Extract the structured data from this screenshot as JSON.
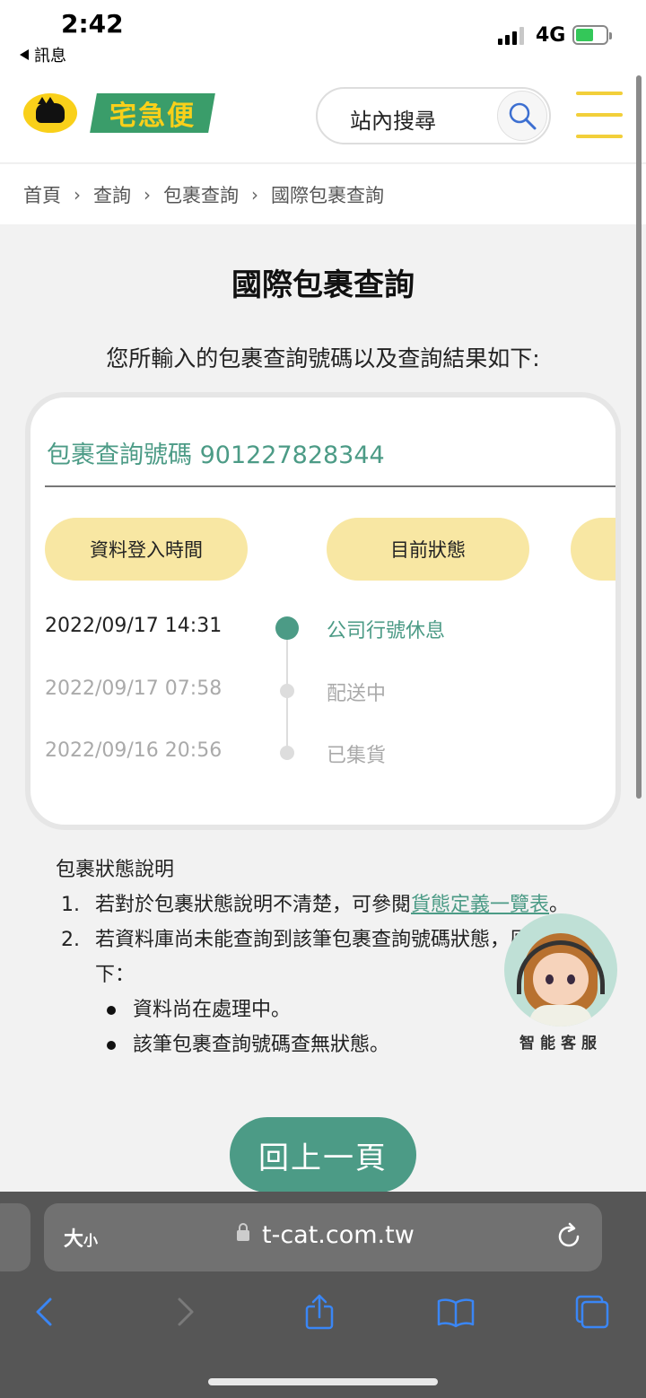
{
  "status_bar": {
    "time": "2:42",
    "back_label": "訊息",
    "network": "4G",
    "battery_percent": 60
  },
  "header": {
    "logo_text": "宅急便",
    "search_label": "站內搜尋"
  },
  "breadcrumb": [
    "首頁",
    "查詢",
    "包裹查詢",
    "國際包裹查詢"
  ],
  "main": {
    "title": "國際包裹查詢",
    "subtitle": "您所輸入的包裹查詢號碼以及查詢結果如下:"
  },
  "card": {
    "tracking_label": "包裹查詢號碼 901227828344",
    "columns": [
      "資料登入時間",
      "目前狀態",
      ""
    ],
    "rows": [
      {
        "time": "2022/09/17 14:31",
        "status": "公司行號休息"
      },
      {
        "time": "2022/09/17 07:58",
        "status": "配送中"
      },
      {
        "time": "2022/09/16 20:56",
        "status": "已集貨"
      }
    ]
  },
  "notes": {
    "heading": "包裹狀態說明",
    "item1_num": "1.",
    "item1_prefix": "若對於包裹狀態說明不清楚，可參閱",
    "item1_link": "貨態定義一覽表",
    "item1_suffix": "。",
    "item2_num": "2.",
    "item2_text": "若資料庫尚未能查詢到該筆包裹查詢號碼狀態，原因如下：",
    "bullets": [
      "資料尚在處理中。",
      "該筆包裹查詢號碼查無狀態。"
    ]
  },
  "chatbot_label": "智能客服",
  "back_button": "回上一頁",
  "browser": {
    "text_size": "大",
    "text_size_small": "小",
    "url": "t-cat.com.tw"
  },
  "colors": {
    "brand_green": "#4c9b86",
    "brand_yellow": "#f9d01a",
    "pill_yellow": "#f8e7a3",
    "logo_green": "#3a9d6a"
  }
}
